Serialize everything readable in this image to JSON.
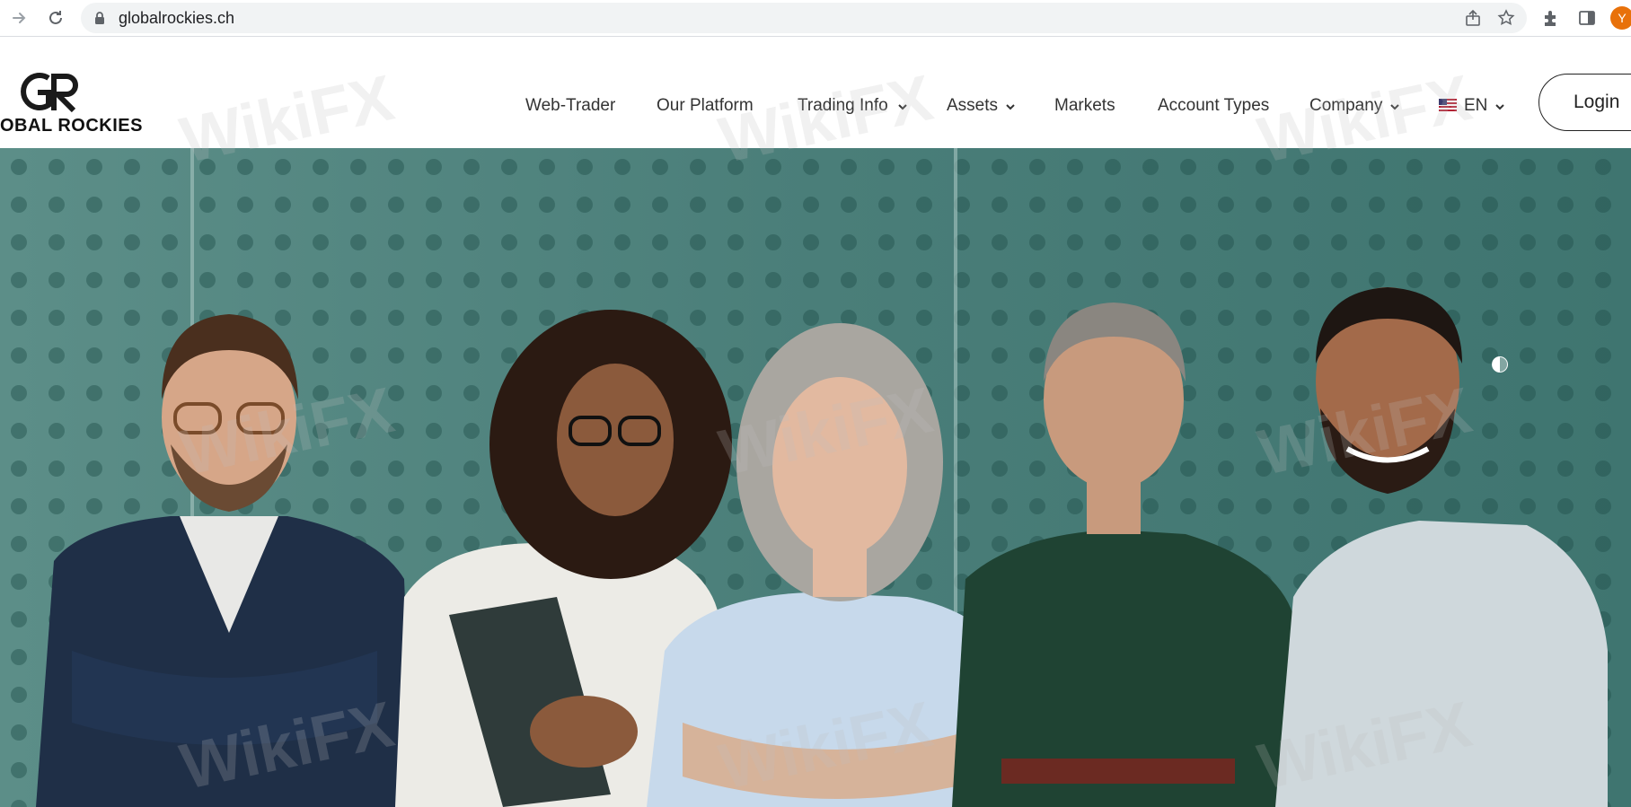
{
  "browser": {
    "url": "globalrockies.ch",
    "profile_initial": "Y",
    "icons": [
      "forward-icon",
      "reload-icon",
      "lock-icon",
      "share-icon",
      "bookmark-star-icon",
      "extensions-icon",
      "side-panel-icon"
    ]
  },
  "site": {
    "logo_text": "OBAL ROCKIES",
    "nav": {
      "web_trader": "Web-Trader",
      "our_platform": "Our Platform",
      "trading_info": "Trading Info",
      "assets": "Assets",
      "markets": "Markets",
      "account_types": "Account Types",
      "company": "Company",
      "language": "EN"
    },
    "login_label": "Login"
  },
  "watermark": "WikiFX",
  "colors": {
    "hero_teal": "#4e8a84",
    "omnibox_bg": "#f1f3f4",
    "profile_orange": "#e8710a",
    "text_dark": "#333333"
  }
}
